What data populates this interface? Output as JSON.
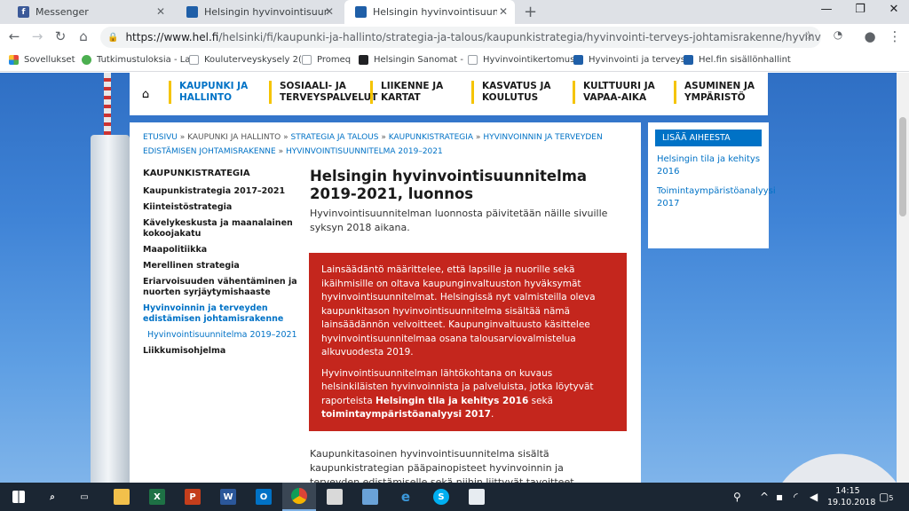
{
  "tabs": [
    {
      "title": "Messenger",
      "icon": "facebook-icon",
      "color": "#3b5998"
    },
    {
      "title": "Helsingin hyvinvointisuunnitelma",
      "icon": "hel-fi-icon",
      "color": "#1f5fa8"
    },
    {
      "title": "Helsingin hyvinvointisuunnitelma",
      "icon": "hel-fi-icon",
      "color": "#1f5fa8"
    }
  ],
  "address": {
    "host": "https://www.hel.fi",
    "path": "/helsinki/fi/kaupunki-ja-hallinto/strategia-ja-talous/kaupunkistrategia/hyvinvointi-terveys-johtamisrakenne/hyvinvointisuunnitelma/"
  },
  "bookmarks": [
    {
      "label": "Sovellukset",
      "icon": "apps-icon",
      "color": "#e8453c"
    },
    {
      "label": "Tutkimustuloksia - La",
      "icon": "green-leaf-icon",
      "color": "#4caf50"
    },
    {
      "label": "Kouluterveyskysely 2(",
      "icon": "page-icon",
      "color": "#9aa0a6"
    },
    {
      "label": "Promeq",
      "icon": "page-icon",
      "color": "#9aa0a6"
    },
    {
      "label": "Helsingin Sanomat -",
      "icon": "hs-icon",
      "color": "#202124"
    },
    {
      "label": "Hyvinvointikertomus",
      "icon": "page-icon",
      "color": "#9aa0a6"
    },
    {
      "label": "Hyvinvointi ja terveys",
      "icon": "hel-fi-icon",
      "color": "#1f5fa8"
    },
    {
      "label": "Hel.fin sisällönhallint",
      "icon": "hel-fi-icon",
      "color": "#1f5fa8"
    }
  ],
  "sitenav": {
    "items": [
      {
        "label1": "KAUPUNKI JA",
        "label2": "HALLINTO"
      },
      {
        "label1": "SOSIAALI- JA",
        "label2": "TERVEYSPALVELUT"
      },
      {
        "label1": "LIIKENNE JA",
        "label2": "KARTAT"
      },
      {
        "label1": "KASVATUS JA",
        "label2": "KOULUTUS"
      },
      {
        "label1": "KULTTUURI JA",
        "label2": "VAPAA-AIKA"
      },
      {
        "label1": "ASUMINEN JA",
        "label2": "YMPÄRISTÖ"
      }
    ]
  },
  "breadcrumb": {
    "etusivu": "ETUSIVU",
    "kaupunki": "KAUPUNKI JA HALLINTO",
    "strategia": "STRATEGIA JA TALOUS",
    "kaupunkistrategia": "KAUPUNKISTRATEGIA",
    "hyvinvointi": "HYVINVOINNIN JA TERVEYDEN EDISTÄMISEN JOHTAMISRAKENNE",
    "current": "HYVINVOINTISUUNNITELMA 2019–2021",
    "sep": "»"
  },
  "sidenav": {
    "heading": "KAUPUNKISTRATEGIA",
    "items": [
      "Kaupunkistrategia 2017–2021",
      "Kiinteistöstrategia",
      "Kävelykeskusta ja maanalainen kokoojakatu",
      "Maapolitiikka",
      "Merellinen strategia",
      "Eriarvoisuuden vähentäminen ja nuorten syrjäytymishaaste"
    ],
    "active": "Hyvinvoinnin ja terveyden edistämisen johtamisrakenne",
    "sub": "Hyvinvointisuunnitelma 2019–2021",
    "last": "Liikkumisohjelma"
  },
  "main": {
    "title": "Helsingin hyvinvointisuunnitelma 2019-2021, luonnos",
    "lead": "Hyvinvointisuunnitelman luonnosta päivitetään näille sivuille syksyn 2018 aikana.",
    "notice_p1": "Lainsäädäntö määrittelee, että lapsille ja nuorille sekä ikäihmisille on oltava kaupunginvaltuuston hyväksymät hyvinvointisuunnitelmat. Helsingissä nyt valmisteilla oleva kaupunkitason hyvinvointisuunnitelma sisältää nämä lainsäädännön velvoitteet. Kaupunginvaltuusto käsittelee hyvinvointisuunnitelmaa osana talousarviovalmistelua alkuvuodesta 2019.",
    "notice_p2_a": "Hyvinvointisuunnitelman lähtökohtana on kuvaus helsinkiläisten hyvinvoinnista ja palveluista, jotka löytyvät raporteista ",
    "notice_p2_b": "Helsingin tila ja kehitys 2016",
    "notice_p2_c": " sekä ",
    "notice_p2_d": "toimintaympäristöanalyysi 2017",
    "notice_p2_e": ".",
    "body": "Kaupunkitasoinen hyvinvointisuunnitelma sisältä kaupunkistrategian pääpainopisteet hyvinvoinnin ja terveyden edistämiselle sekä niihin liittyvät tavoitteet, toimenpiteet ja"
  },
  "aside": {
    "heading": "LISÄÄ AIHEESTA",
    "links": [
      "Helsingin tila ja kehitys 2016",
      "Toimintaympäristöanalyysi 2017"
    ]
  },
  "taskbar": {
    "time": "14:15",
    "date": "19.10.2018",
    "notifications": "5"
  }
}
